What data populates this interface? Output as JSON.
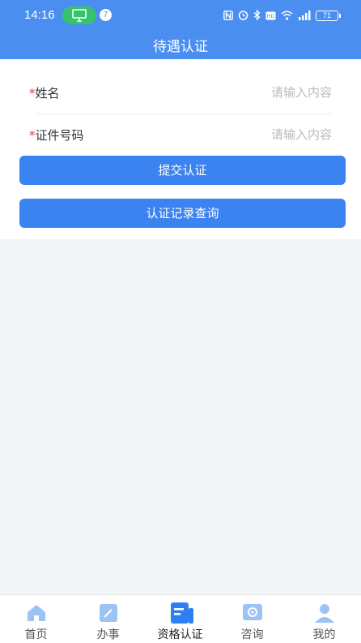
{
  "status_bar": {
    "time": "14:16",
    "notification_count": "7",
    "battery": "71"
  },
  "header": {
    "title": "待遇认证"
  },
  "form": {
    "fields": [
      {
        "required_mark": "*",
        "label": "姓名",
        "placeholder": "请输入内容"
      },
      {
        "required_mark": "*",
        "label": "证件号码",
        "placeholder": "请输入内容"
      }
    ],
    "submit_label": "提交认证",
    "query_label": "认证记录查询"
  },
  "tabbar": {
    "items": [
      {
        "label": "首页",
        "icon": "home-icon"
      },
      {
        "label": "办事",
        "icon": "edit-icon"
      },
      {
        "label": "资格认证",
        "icon": "certification-icon",
        "active": true
      },
      {
        "label": "咨询",
        "icon": "consult-icon"
      },
      {
        "label": "我的",
        "icon": "profile-icon"
      }
    ]
  },
  "colors": {
    "header": "#4a8ff0",
    "button": "#3a83f0",
    "required": "#e53935",
    "tab_icon": "#9cc3f5",
    "tab_icon_active": "#2f7ff0"
  }
}
